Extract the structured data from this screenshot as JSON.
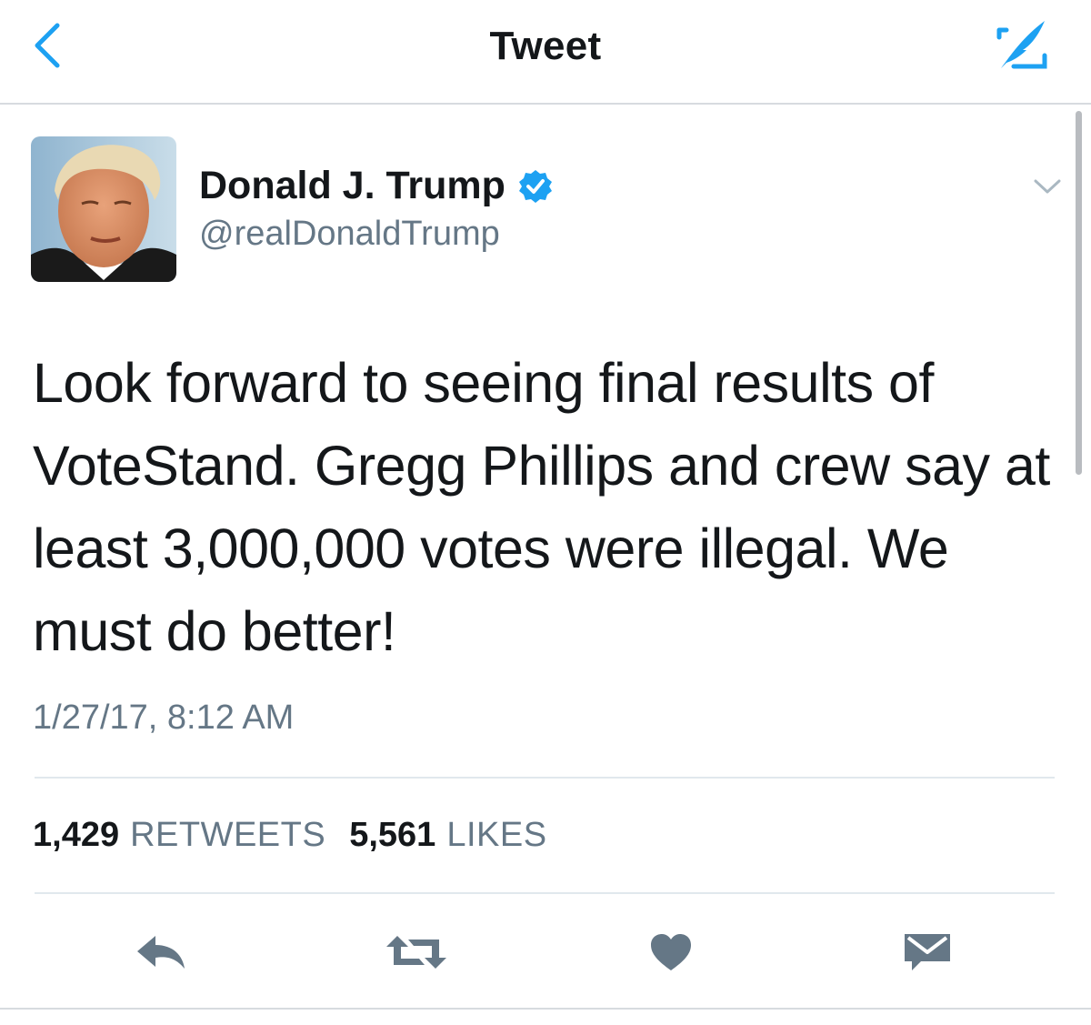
{
  "nav": {
    "title": "Tweet",
    "back_icon": "chevron-left-icon",
    "compose_icon": "compose-tweet-icon",
    "accent_color": "#1da1f2"
  },
  "author": {
    "name": "Donald J. Trump",
    "handle": "@realDonaldTrump",
    "verified": true,
    "verified_icon": "verified-badge-icon"
  },
  "tweet": {
    "text": "Look forward to seeing final results of VoteStand. Gregg Phillips and crew say at least 3,000,000 votes were illegal. We must do better!",
    "timestamp": "1/27/17, 8:12 AM"
  },
  "stats": {
    "retweets_count": "1,429",
    "retweets_label": "RETWEETS",
    "likes_count": "5,561",
    "likes_label": "LIKES"
  },
  "actions": [
    {
      "name": "reply",
      "icon": "reply-icon"
    },
    {
      "name": "retweet",
      "icon": "retweet-icon"
    },
    {
      "name": "like",
      "icon": "heart-icon"
    },
    {
      "name": "direct-message",
      "icon": "envelope-icon"
    }
  ],
  "colors": {
    "text_primary": "#14171a",
    "text_secondary": "#657786",
    "icon_gray": "#657786",
    "divider": "#e1e8ed"
  }
}
